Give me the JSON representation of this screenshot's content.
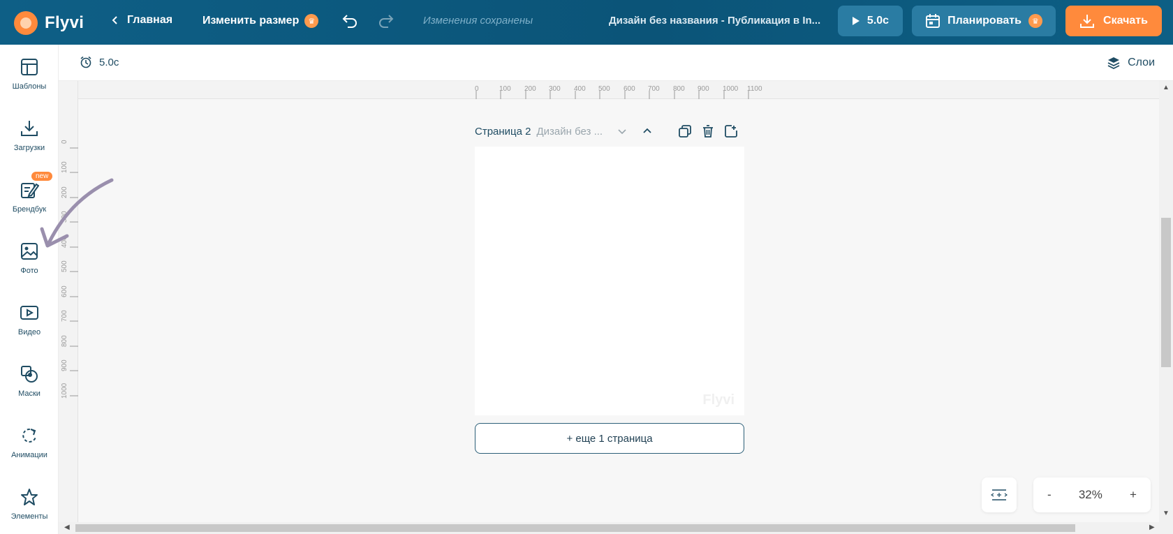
{
  "header": {
    "logo_text": "Flyvi",
    "home_label": "Главная",
    "resize_label": "Изменить размер",
    "saved_status": "Изменения сохранены",
    "document_title": "Дизайн без названия - Публикация в In...",
    "play_label": "5.0с",
    "plan_label": "Планировать",
    "download_label": "Скачать"
  },
  "sidebar": {
    "items": [
      {
        "label": "Шаблоны",
        "icon": "templates-icon"
      },
      {
        "label": "Загрузки",
        "icon": "upload-icon"
      },
      {
        "label": "Брендбук",
        "icon": "brandbook-icon",
        "badge": "new"
      },
      {
        "label": "Фото",
        "icon": "photo-icon"
      },
      {
        "label": "Видео",
        "icon": "video-icon"
      },
      {
        "label": "Маски",
        "icon": "masks-icon"
      },
      {
        "label": "Анимации",
        "icon": "animation-icon"
      },
      {
        "label": "Элементы",
        "icon": "star-icon"
      }
    ]
  },
  "subbar": {
    "duration": "5.0с",
    "layers_label": "Слои"
  },
  "ruler": {
    "top_ticks": [
      "0",
      "100",
      "200",
      "300",
      "400",
      "500",
      "600",
      "700",
      "800",
      "900",
      "1000",
      "1100"
    ],
    "left_ticks": [
      "0",
      "100",
      "200",
      "300",
      "400",
      "500",
      "600",
      "700",
      "800",
      "900",
      "1000"
    ]
  },
  "page": {
    "name": "Страница 2",
    "subtitle": "Дизайн без ...",
    "watermark": "Flyvi",
    "add_page_label": "+ еще 1 страница"
  },
  "zoom": {
    "minus": "-",
    "value": "32%",
    "plus": "+"
  },
  "colors": {
    "header_bg": "#0b5478",
    "accent_orange": "#ff8a3c",
    "button_blue": "#2a7ca3",
    "text_dark": "#1f4c63"
  }
}
